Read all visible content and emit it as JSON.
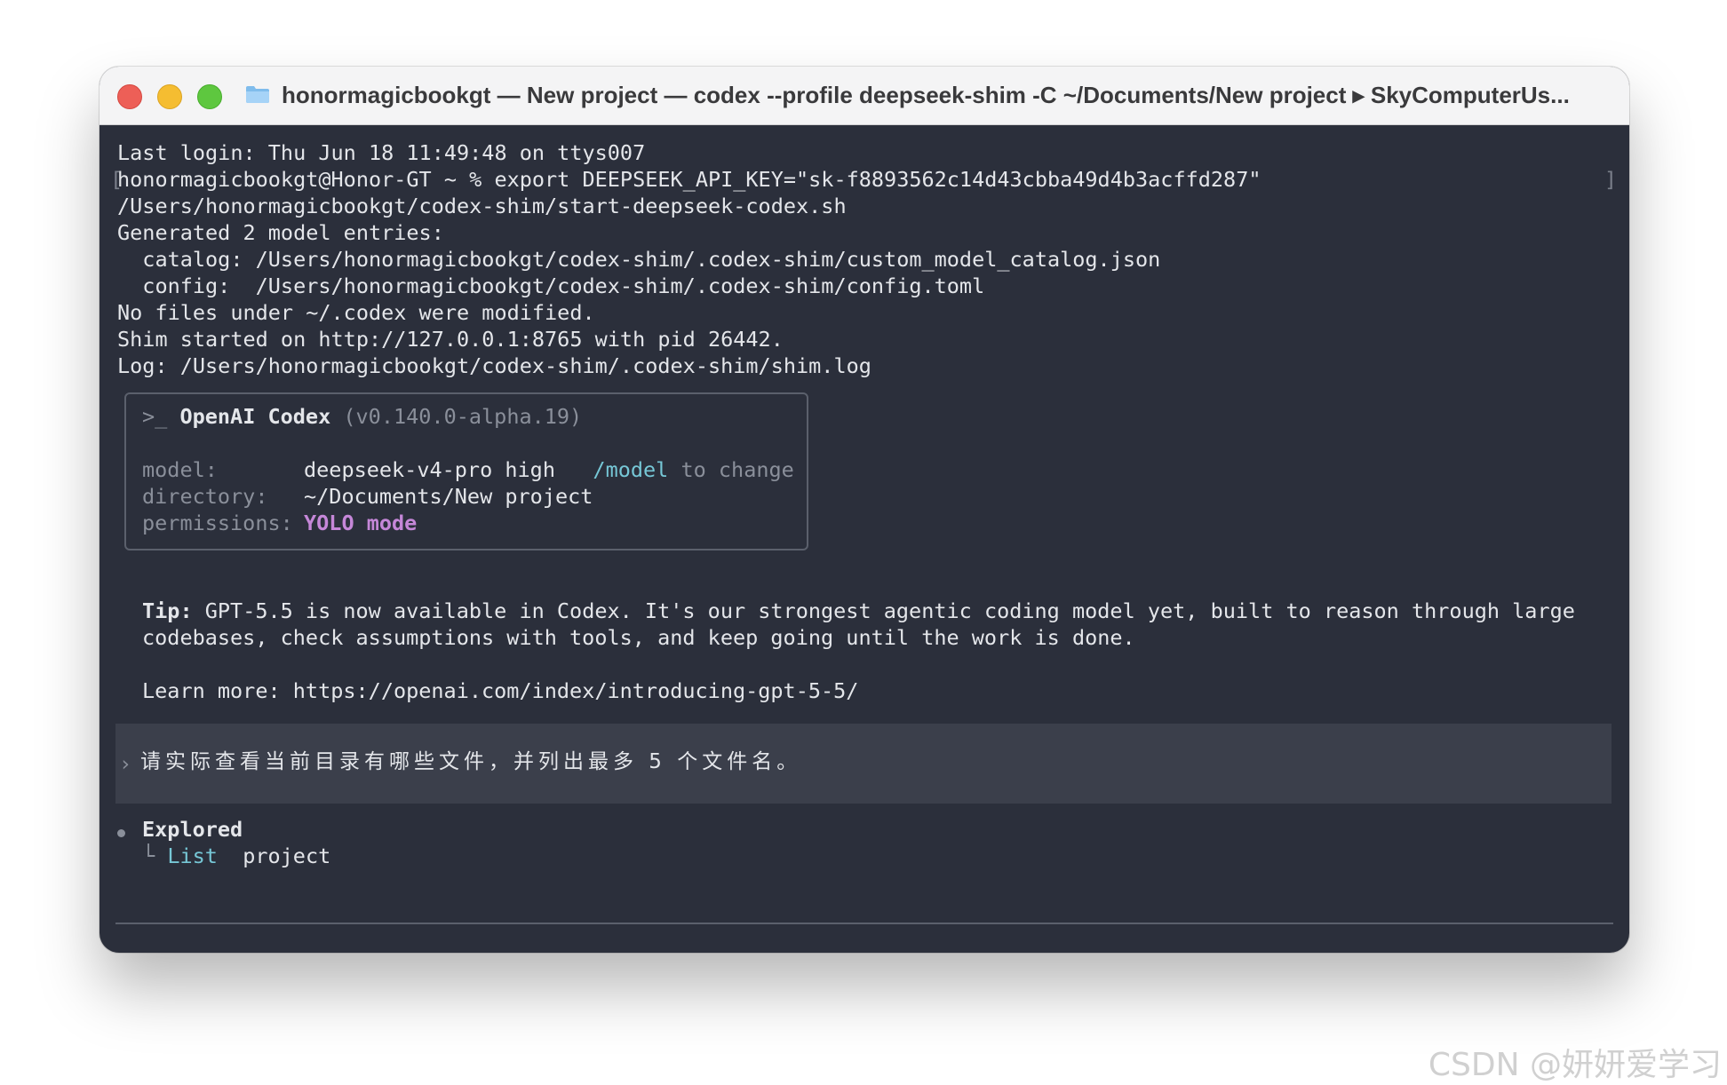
{
  "window": {
    "title": "honormagicbookgt — New project — codex --profile deepseek-shim -C ~/Documents/New project ▸ SkyComputerUs..."
  },
  "terminal": {
    "lines": [
      "Last login: Thu Jun 18 11:49:48 on ttys007",
      "honormagicbookgt@Honor-GT ~ % export DEEPSEEK_API_KEY=\"sk-f8893562c14d43cbba49d4b3acffd287\"",
      "/Users/honormagicbookgt/codex-shim/start-deepseek-codex.sh",
      "Generated 2 model entries:",
      "  catalog: /Users/honormagicbookgt/codex-shim/.codex-shim/custom_model_catalog.json",
      "  config:  /Users/honormagicbookgt/codex-shim/.codex-shim/config.toml",
      "No files under ~/.codex were modified.",
      "Shim started on http://127.0.0.1:8765 with pid 26442.",
      "Log: /Users/honormagicbookgt/codex-shim/.codex-shim/shim.log"
    ],
    "bracket_left": "[",
    "bracket_right": "]"
  },
  "codex_box": {
    "prompt_glyph": ">_",
    "name": "OpenAI Codex",
    "version": "(v0.140.0-alpha.19)",
    "model_label": "model:",
    "model_value": "deepseek-v4-pro high",
    "model_cmd": "/model",
    "model_hint": "to change",
    "directory_label": "directory:",
    "directory_value": "~/Documents/New project",
    "permissions_label": "permissions:",
    "permissions_value": "YOLO mode"
  },
  "tip": {
    "label": "Tip:",
    "line1": "GPT-5.5 is now available in Codex. It's our strongest agentic coding model yet, built to reason through large",
    "line2": "codebases, check assumptions with tools, and keep going until the work is done.",
    "learn_more": "Learn more: https://openai.com/index/introducing-gpt-5-5/"
  },
  "prompt": {
    "chevron": "›",
    "text": "请实际查看当前目录有哪些文件，并列出最多 5 个文件名。"
  },
  "explored": {
    "title": "Explored",
    "branch": "└",
    "action": "List",
    "target": "project"
  },
  "watermark": "CSDN @妍妍爱学习"
}
